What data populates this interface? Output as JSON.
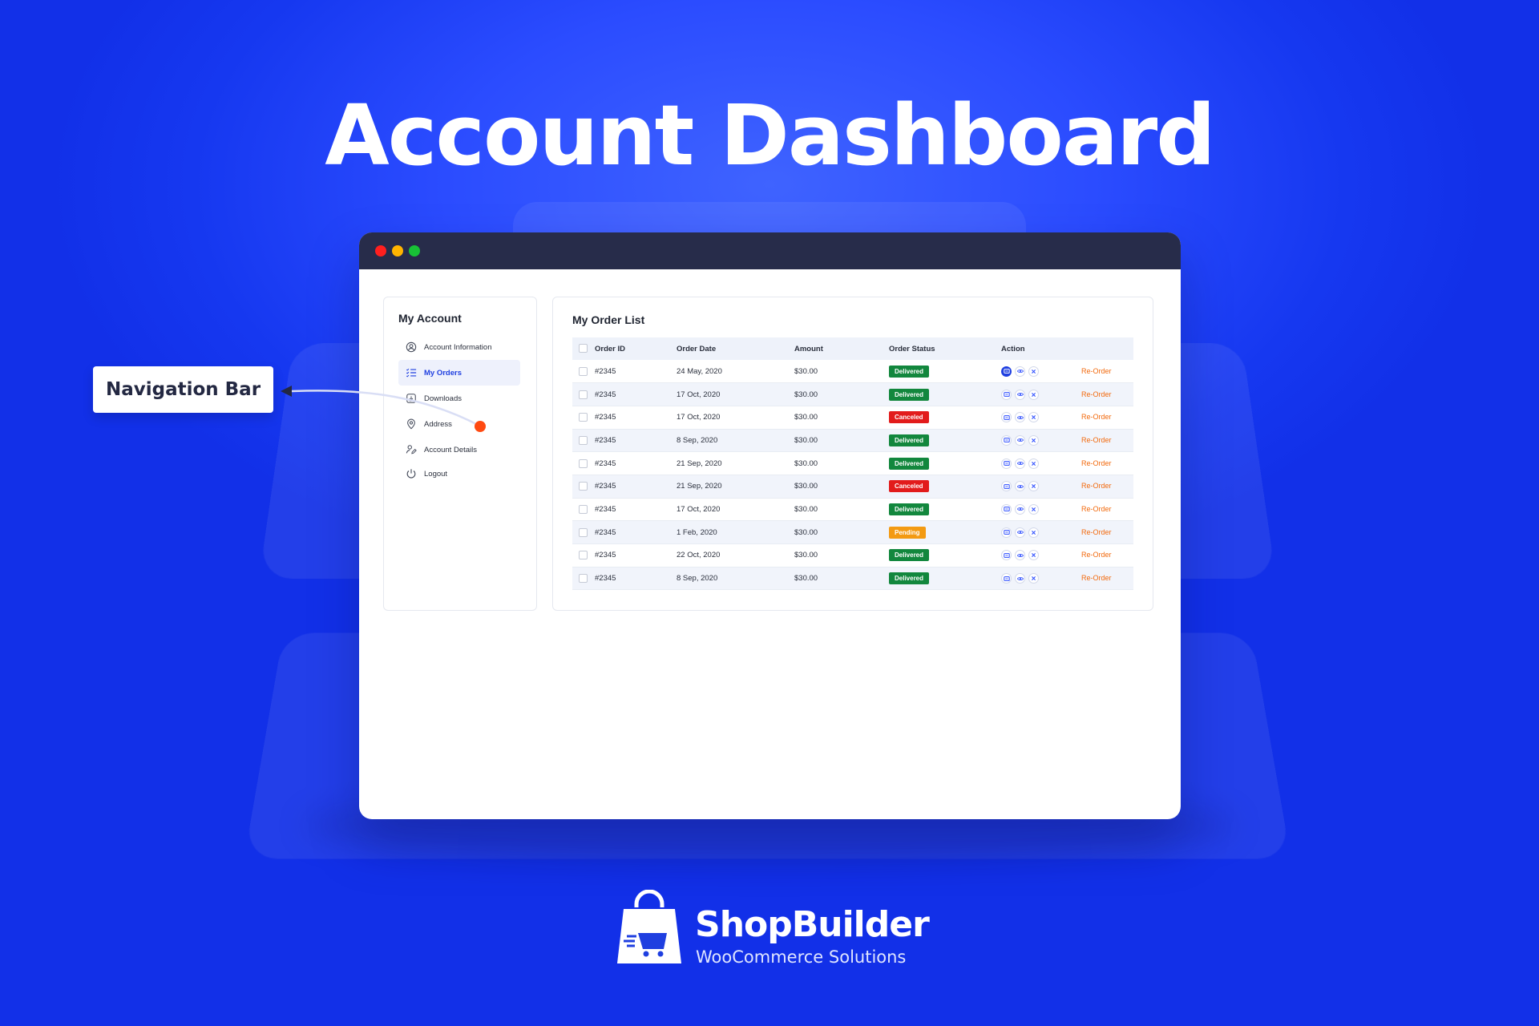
{
  "hero": {
    "title": "Account Dashboard"
  },
  "callout": {
    "label": "Navigation Bar"
  },
  "sidebar": {
    "title": "My Account",
    "items": [
      {
        "label": "Account Information",
        "icon": "user-circle-icon",
        "active": false
      },
      {
        "label": "My Orders",
        "icon": "list-icon",
        "active": true
      },
      {
        "label": "Downloads",
        "icon": "download-icon",
        "active": false
      },
      {
        "label": "Address",
        "icon": "map-pin-icon",
        "active": false
      },
      {
        "label": "Account Details",
        "icon": "user-edit-icon",
        "active": false
      },
      {
        "label": "Logout",
        "icon": "power-icon",
        "active": false
      }
    ]
  },
  "orders": {
    "title": "My Order List",
    "columns": [
      "Order ID",
      "Order Date",
      "Amount",
      "Order Status",
      "Action"
    ],
    "reorder_label": "Re-Order",
    "rows": [
      {
        "id": "#2345",
        "date": "24 May, 2020",
        "amount": "$30.00",
        "status": "Delivered"
      },
      {
        "id": "#2345",
        "date": "17 Oct, 2020",
        "amount": "$30.00",
        "status": "Delivered"
      },
      {
        "id": "#2345",
        "date": "17 Oct, 2020",
        "amount": "$30.00",
        "status": "Canceled"
      },
      {
        "id": "#2345",
        "date": "8 Sep, 2020",
        "amount": "$30.00",
        "status": "Delivered"
      },
      {
        "id": "#2345",
        "date": "21 Sep, 2020",
        "amount": "$30.00",
        "status": "Delivered"
      },
      {
        "id": "#2345",
        "date": "21 Sep, 2020",
        "amount": "$30.00",
        "status": "Canceled"
      },
      {
        "id": "#2345",
        "date": "17 Oct, 2020",
        "amount": "$30.00",
        "status": "Delivered"
      },
      {
        "id": "#2345",
        "date": "1 Feb, 2020",
        "amount": "$30.00",
        "status": "Pending"
      },
      {
        "id": "#2345",
        "date": "22 Oct, 2020",
        "amount": "$30.00",
        "status": "Delivered"
      },
      {
        "id": "#2345",
        "date": "8 Sep, 2020",
        "amount": "$30.00",
        "status": "Delivered"
      }
    ]
  },
  "brand": {
    "name": "ShopBuilder",
    "tagline": "WooCommerce Solutions"
  },
  "colors": {
    "background": "#2b4cff",
    "titlebar": "#272c4a",
    "delivered": "#12873d",
    "canceled": "#e21b1b",
    "pending": "#f39a12",
    "reorder": "#f26a0e",
    "accent": "#1f3fe0",
    "marker": "#ff4a12"
  }
}
